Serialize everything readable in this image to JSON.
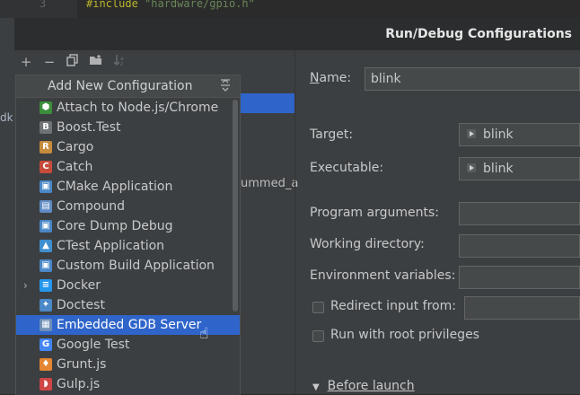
{
  "editor": {
    "line_number": "3",
    "code_keyword": "#include",
    "code_string": "\"hardware/gpio.h\"",
    "left_strip_label": "dk",
    "tree_partial_text": "ummed_a"
  },
  "dialog": {
    "title": "Run/Debug Configurations"
  },
  "toolbar": {
    "add_icon": "plus-icon",
    "remove_icon": "minus-icon",
    "copy_icon": "copy-icon",
    "folder_icon": "folder-icon",
    "sort_icon": "sort-icon"
  },
  "popup": {
    "title": "Add New Configuration",
    "items": [
      {
        "label": "Attach to Node.js/Chrome",
        "icon": "nodejs-icon",
        "color": "#3b8f3b"
      },
      {
        "label": "Boost.Test",
        "icon": "boost-test-icon",
        "color": "#6f7376"
      },
      {
        "label": "Cargo",
        "icon": "cargo-icon",
        "color": "#c68b3b"
      },
      {
        "label": "Catch",
        "icon": "catch-icon",
        "color": "#c64b3b"
      },
      {
        "label": "CMake Application",
        "icon": "cmake-icon",
        "color": "#4a88c7"
      },
      {
        "label": "Compound",
        "icon": "compound-icon",
        "color": "#5f8bc4"
      },
      {
        "label": "Core Dump Debug",
        "icon": "core-dump-icon",
        "color": "#4a88c7"
      },
      {
        "label": "CTest Application",
        "icon": "ctest-icon",
        "color": "#3f8fd0"
      },
      {
        "label": "Custom Build Application",
        "icon": "custom-build-icon",
        "color": "#4a88c7"
      },
      {
        "label": "Docker",
        "icon": "docker-icon",
        "color": "#2496ed"
      },
      {
        "label": "Doctest",
        "icon": "doctest-icon",
        "color": "#4a88c7"
      },
      {
        "label": "Embedded GDB Server",
        "icon": "embedded-gdb-icon",
        "color": "#6f8fb8"
      },
      {
        "label": "Google Test",
        "icon": "google-test-icon",
        "color": "#4285f4"
      },
      {
        "label": "Grunt.js",
        "icon": "grunt-icon",
        "color": "#e48632"
      },
      {
        "label": "Gulp.js",
        "icon": "gulp-icon",
        "color": "#cf4647"
      }
    ]
  },
  "form": {
    "name_label": "Name:",
    "name_value": "blink",
    "target_label": "Target:",
    "target_value": "blink",
    "executable_label": "Executable:",
    "executable_value": "blink",
    "program_args_label": "Program arguments:",
    "working_dir_label": "Working directory:",
    "env_vars_label": "Environment variables:",
    "redirect_label": "Redirect input from:",
    "root_priv_label": "Run with root privileges",
    "before_launch_label": "Before launch"
  }
}
